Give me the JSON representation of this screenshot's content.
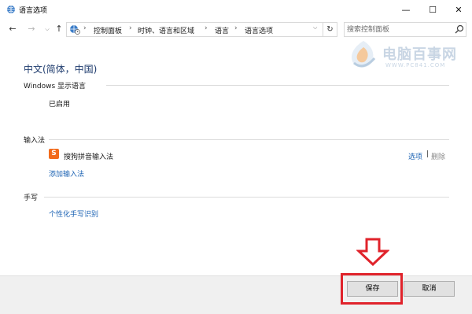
{
  "window": {
    "title": "语言选项",
    "controls": {
      "minimize": "—",
      "maximize": "☐",
      "close": "✕"
    }
  },
  "nav": {
    "back": "←",
    "forward": "→",
    "dropdown": "⌵",
    "up": "↑",
    "breadcrumb": [
      "控制面板",
      "时钟、语言和区域",
      "语言",
      "语言选项"
    ],
    "separator": "›",
    "refresh": "↻",
    "search_placeholder": "搜索控制面板"
  },
  "main": {
    "language_heading": "中文(简体，中国)",
    "sections": {
      "display_language": {
        "title": "Windows 显示语言",
        "status": "已启用"
      },
      "input_method": {
        "title": "输入法",
        "ime_icon_letter": "S",
        "ime_name": "搜狗拼音输入法",
        "options_link": "选项",
        "link_separator": "|",
        "remove_link": "删除",
        "add_link": "添加输入法"
      },
      "handwriting": {
        "title": "手写",
        "personalize_link": "个性化手写识别"
      }
    }
  },
  "watermark": {
    "brand": "电脑百事网",
    "url": "WWW.PC841.COM"
  },
  "footer": {
    "save_label": "保存",
    "cancel_label": "取消"
  },
  "colors": {
    "heading": "#1f3c6e",
    "link": "#1e64b4",
    "highlight": "#e0232b",
    "sogou_orange": "#f26a1b",
    "footer_bg": "#f0f0f0"
  },
  "icons": {
    "app": "globe-clock-icon",
    "address": "globe-clock-icon",
    "search": "magnifier-icon",
    "ime": "sogou-icon",
    "arrow": "down-arrow-annotation"
  }
}
